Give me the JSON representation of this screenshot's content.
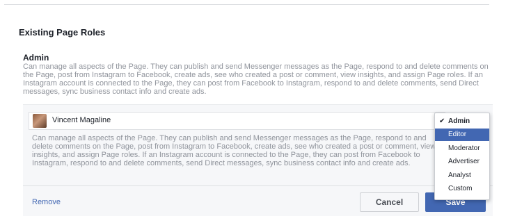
{
  "section": {
    "title": "Existing Page Roles"
  },
  "admin_role": {
    "name": "Admin",
    "description": "Can manage all aspects of the Page. They can publish and send Messenger messages as the Page, respond to and delete comments on the Page, post from Instagram to Facebook, create ads, see who created a post or comment, view insights, and assign Page roles. If an Instagram account is connected to the Page, they can post from Facebook to Instagram, respond to and delete comments, send Direct messages, sync business contact info and create ads."
  },
  "person": {
    "name": "Vincent Magaline",
    "description": "Can manage all aspects of the Page. They can publish and send Messenger messages as the Page, respond to and delete comments on the Page, post from Instagram to Facebook, create ads, see who created a post or comment, view insights, and assign Page roles. If an Instagram account is connected to the Page, they can post from Facebook to Instagram, respond to and delete comments, send Direct messages, sync business contact info and create ads."
  },
  "actions": {
    "remove": "Remove",
    "cancel": "Cancel",
    "save": "Save"
  },
  "role_menu": {
    "selected": "Admin",
    "highlighted": "Editor",
    "options": [
      "Admin",
      "Editor",
      "Moderator",
      "Advertiser",
      "Analyst",
      "Custom"
    ]
  },
  "colors": {
    "accent": "#4267b2",
    "muted_text": "#90949c"
  }
}
